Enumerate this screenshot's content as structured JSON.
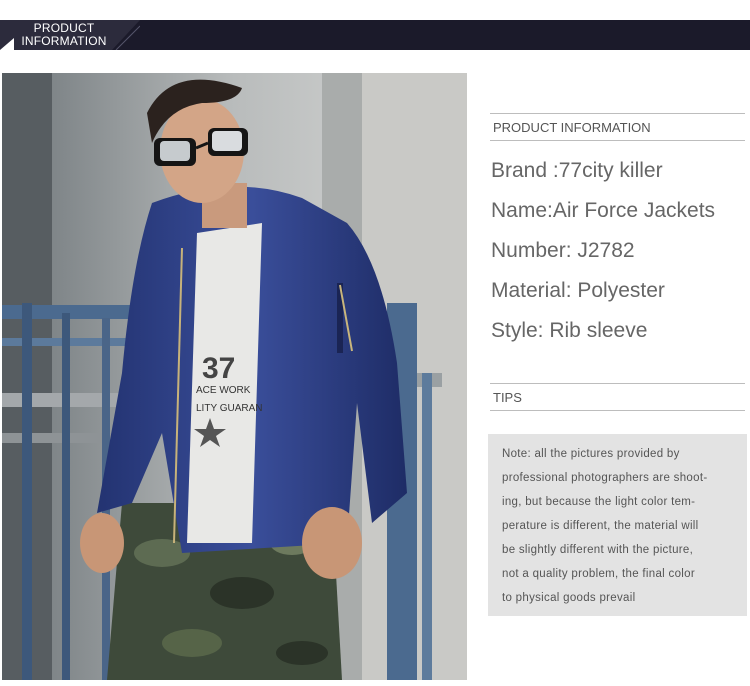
{
  "banner": {
    "line1": "PRODUCT",
    "line2": "INFORMATION"
  },
  "info_section": {
    "header": "PRODUCT INFORMATION",
    "specs": [
      "Brand :77city killer",
      "Name:Air Force Jackets",
      "Number: J2782",
      "Material: Polyester",
      "Style: Rib sleeve"
    ]
  },
  "tips_section": {
    "header": "TIPS",
    "note_lines": [
      "Note: all the pictures provided by",
      "professional photographers are shoot-",
      "ing, but because the light color tem-",
      "perature is different, the material will",
      "be slightly different with the picture,",
      "not a quality problem, the final color",
      "to physical goods prevail"
    ]
  },
  "photo": {
    "shirt_print_line1": "ACE WORK",
    "shirt_print_line2": "LITY GUARAN",
    "shirt_print_big": "37"
  },
  "colors": {
    "banner_bg": "#1b1a2a",
    "jacket_blue": "#2c3f86",
    "note_bg": "#e3e3e3",
    "text_gray": "#666666"
  }
}
